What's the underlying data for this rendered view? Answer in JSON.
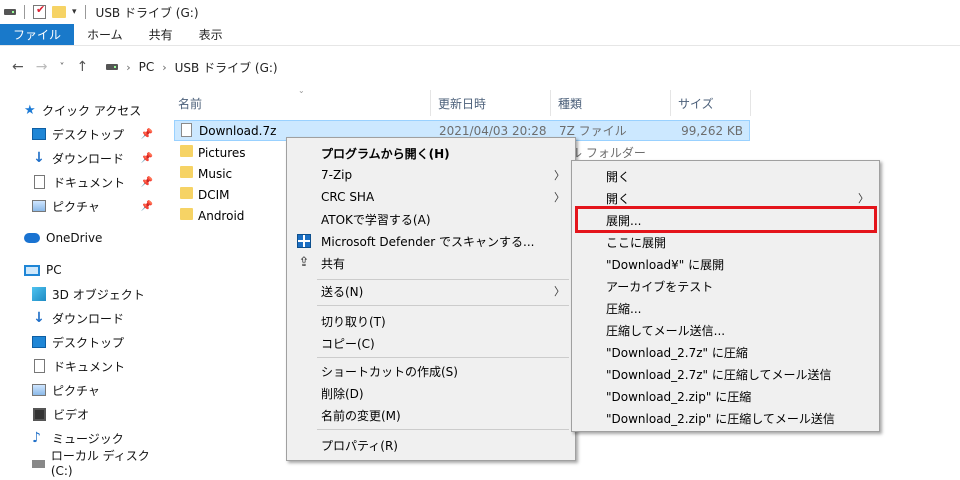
{
  "titlebar": {
    "title": "USB ドライブ (G:)",
    "dropdown": "▾"
  },
  "ribbon": {
    "tabs": [
      "ファイル",
      "ホーム",
      "共有",
      "表示"
    ]
  },
  "addressbar": {
    "back": "←",
    "forward": "→",
    "recent": "˅",
    "up": "↑",
    "path": [
      "PC",
      "USB ドライブ (G:)"
    ],
    "separator": "›"
  },
  "navpane": {
    "quick_access": "クイック アクセス",
    "quick_items": [
      "デスクトップ",
      "ダウンロード",
      "ドキュメント",
      "ピクチャ"
    ],
    "onedrive": "OneDrive",
    "pc": "PC",
    "pc_items": [
      "3D オブジェクト",
      "ダウンロード",
      "デスクトップ",
      "ドキュメント",
      "ピクチャ",
      "ビデオ",
      "ミュージック",
      "ローカル ディスク (C:)"
    ],
    "pin_glyph": "📌"
  },
  "filelist": {
    "columns": [
      "名前",
      "更新日時",
      "種類",
      "サイズ"
    ],
    "files": [
      {
        "name": "Download.7z",
        "date": "2021/04/03 20:28",
        "type": "7Z ファイル",
        "size": "99,262 KB",
        "selected": true
      },
      {
        "name": "Pictures",
        "date": "",
        "type": "イル フォルダー",
        "size": ""
      },
      {
        "name": "Music",
        "date": "",
        "type": "",
        "size": ""
      },
      {
        "name": "DCIM",
        "date": "",
        "type": "",
        "size": ""
      },
      {
        "name": "Android",
        "date": "",
        "type": "",
        "size": ""
      }
    ]
  },
  "context_menu": {
    "items": [
      "プログラムから開く(H)",
      "7-Zip",
      "CRC SHA",
      "ATOKで学習する(A)",
      "Microsoft Defender でスキャンする...",
      "共有",
      "送る(N)",
      "切り取り(T)",
      "コピー(C)",
      "ショートカットの作成(S)",
      "削除(D)",
      "名前の変更(M)",
      "プロパティ(R)"
    ],
    "submenu_arrow": "〉"
  },
  "zip_submenu": {
    "items": [
      "開く",
      "開く",
      "展開...",
      "ここに展開",
      "\"Download¥\" に展開",
      "アーカイブをテスト",
      "圧縮...",
      "圧縮してメール送信...",
      "\"Download_2.7z\" に圧縮",
      "\"Download_2.7z\" に圧縮してメール送信",
      "\"Download_2.zip\" に圧縮",
      "\"Download_2.zip\" に圧縮してメール送信"
    ],
    "highlight_color": "#e4141b"
  }
}
